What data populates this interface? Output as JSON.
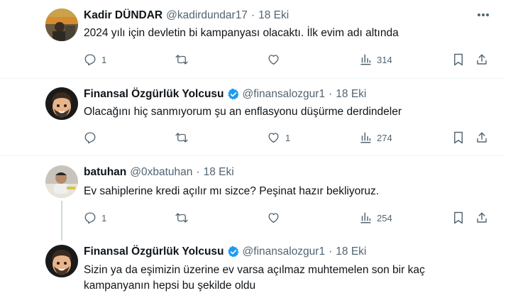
{
  "tweets": [
    {
      "name": "Kadir DÜNDAR",
      "handle": "@kadirdundar17",
      "separator": "·",
      "date": "18 Eki",
      "verified": false,
      "text": "2024 yılı için devletin bi kampanyası olacaktı. İlk evim adı altında",
      "replies": "1",
      "retweets": "",
      "likes": "",
      "views": "314"
    },
    {
      "name": "Finansal Özgürlük Yolcusu",
      "handle": "@finansalozgur1",
      "separator": "·",
      "date": "18 Eki",
      "verified": true,
      "text": "Olacağını hiç sanmıyorum şu an enflasyonu düşürme derdindeler",
      "replies": "",
      "retweets": "",
      "likes": "1",
      "views": "274"
    },
    {
      "name": "batuhan",
      "handle": "@0xbatuhan",
      "separator": "·",
      "date": "18 Eki",
      "verified": false,
      "text": "Ev sahiplerine kredi açılır mı sizce? Peşinat hazır bekliyoruz.",
      "replies": "1",
      "retweets": "",
      "likes": "",
      "views": "254"
    },
    {
      "name": "Finansal Özgürlük Yolcusu",
      "handle": "@finansalozgur1",
      "separator": "·",
      "date": "18 Eki",
      "verified": true,
      "text_line1": "Sizin ya da eşimizin üzerine ev varsa açılmaz muhtemelen son bir kaç",
      "text_line2": "kampanyanın hepsi bu şekilde oldu"
    }
  ],
  "colors": {
    "text_primary": "#0f1419",
    "text_secondary": "#536471",
    "verified_blue": "#1d9bf0",
    "divider": "#eff3f4"
  },
  "icons": [
    "reply-icon",
    "retweet-icon",
    "like-icon",
    "views-icon",
    "bookmark-icon",
    "share-icon",
    "more-icon",
    "verified-badge-icon"
  ]
}
